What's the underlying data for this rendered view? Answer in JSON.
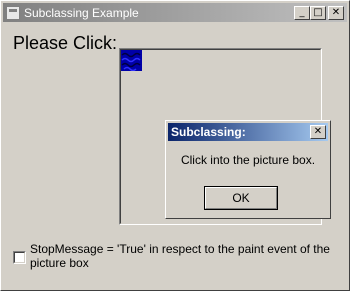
{
  "window": {
    "title": "Subclassing Example",
    "minimize_glyph": "_",
    "maximize_glyph": "□",
    "close_glyph": "✕"
  },
  "main": {
    "prompt_label": "Please Click:",
    "picture_icon": "blue-texture-icon"
  },
  "dialog": {
    "title": "Subclassing:",
    "close_glyph": "✕",
    "message": "Click into the picture box.",
    "ok_label": "OK"
  },
  "option": {
    "checked": false,
    "label": "StopMessage = 'True' in respect to the paint event of the picture box"
  },
  "colors": {
    "face": "#d4d0c8",
    "active_title": "#0a246a",
    "inactive_title": "#808080",
    "icon_blue": "#0000a8"
  }
}
